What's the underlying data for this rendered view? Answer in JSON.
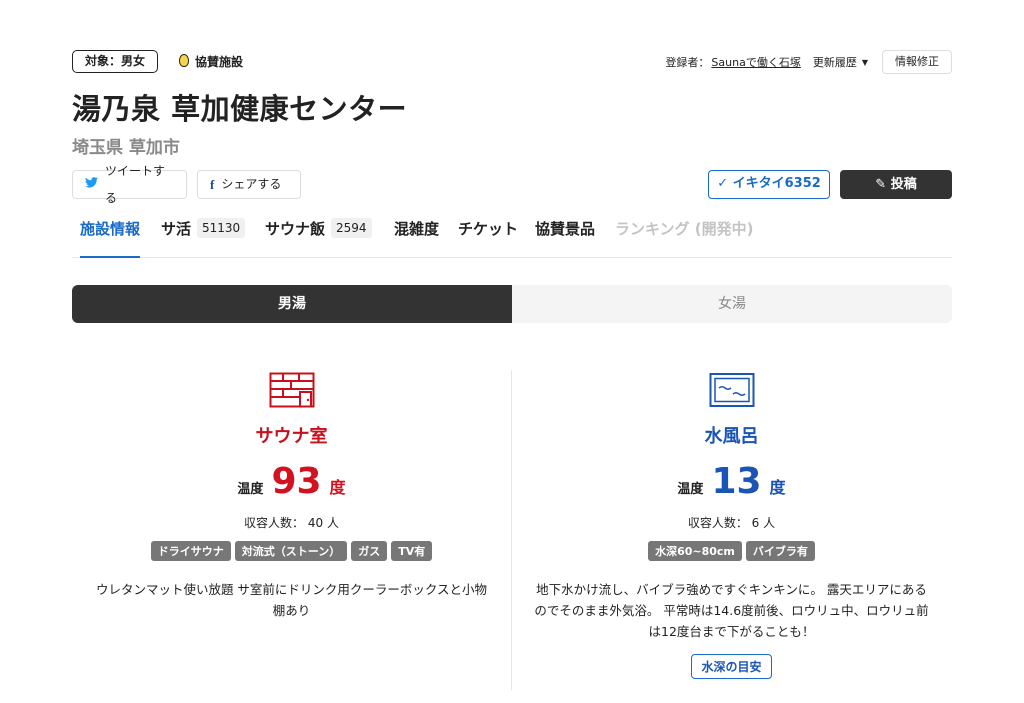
{
  "header": {
    "target_badge": "対象：男女",
    "sponsor_label": "協賛施設",
    "registrant_label": "登録者：",
    "registrant_name": "Saunaで働く石塚",
    "history_label": "更新履歴",
    "edit_label": "情報修正"
  },
  "facility": {
    "name": "湯乃泉 草加健康センター",
    "location": "埼玉県 草加市"
  },
  "actions": {
    "tweet_label": "ツイートする",
    "share_label": "シェアする",
    "ikitai_label": "イキタイ6352",
    "post_label": "投稿"
  },
  "tabs": [
    {
      "label": "施設情報",
      "count": ""
    },
    {
      "label": "サ活",
      "count": "51130"
    },
    {
      "label": "サウナ飯",
      "count": "2594"
    },
    {
      "label": "混雑度",
      "count": ""
    },
    {
      "label": "チケット",
      "count": ""
    },
    {
      "label": "協賛景品",
      "count": ""
    },
    {
      "label": "ランキング (開発中)",
      "count": ""
    }
  ],
  "gender": {
    "male": "男湯",
    "female": "女湯"
  },
  "sauna": {
    "title": "サウナ室",
    "temp_label": "温度",
    "temp_value": "93",
    "temp_unit": "度",
    "capacity": "収容人数： 40 人",
    "tags": [
      "ドライサウナ",
      "対流式（ストーン）",
      "ガス",
      "TV有"
    ],
    "description": "ウレタンマット使い放題 サ室前にドリンク用クーラーボックスと小物棚あり"
  },
  "water": {
    "title": "水風呂",
    "temp_label": "温度",
    "temp_value": "13",
    "temp_unit": "度",
    "capacity": "収容人数： 6 人",
    "tags": [
      "水深60~80cm",
      "バイブラ有"
    ],
    "description": "地下水かけ流し、バイブラ強めですぐキンキンに。 露天エリアにあるのでそのまま外気浴。 平常時は14.6度前後、ロウリュ中、ロウリュ前は12度台まで下がることも！",
    "depth_button": "水深の目安"
  },
  "colors": {
    "accent_blue": "#1a6ac8",
    "sauna_red": "#d4111f",
    "water_blue": "#1a55b5",
    "dark": "#333333"
  }
}
